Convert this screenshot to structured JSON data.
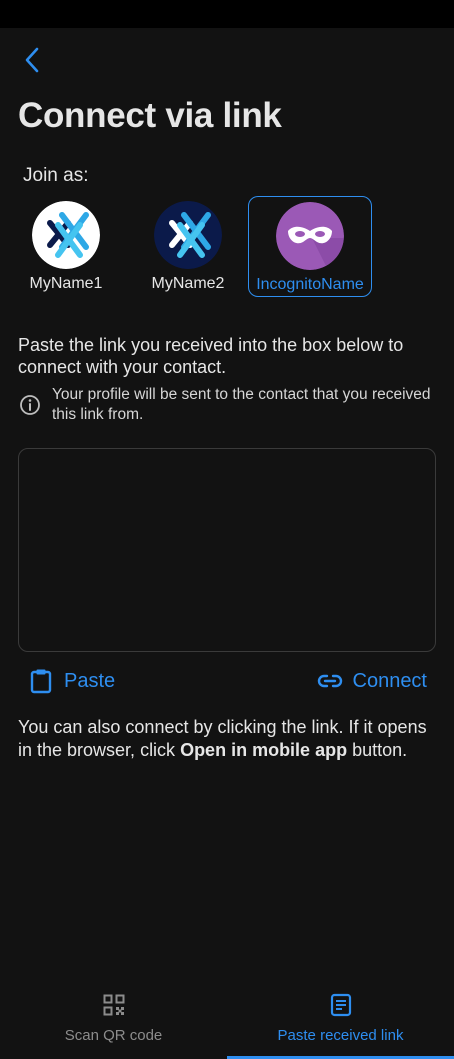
{
  "header": {
    "title": "Connect via link"
  },
  "join_as": {
    "label": "Join as:",
    "profiles": [
      {
        "name": "MyName1",
        "selected": false
      },
      {
        "name": "MyName2",
        "selected": false
      },
      {
        "name": "IncognitoName",
        "selected": true
      }
    ]
  },
  "instructions": "Paste the link you received into the box below to connect with your contact.",
  "info": "Your profile will be sent to the contact that you received this link from.",
  "link_input": {
    "value": "",
    "placeholder": ""
  },
  "actions": {
    "paste_label": "Paste",
    "connect_label": "Connect"
  },
  "also_connect": {
    "prefix": "You can also connect by clicking the link. If it opens in the browser, click ",
    "bold": "Open in mobile app",
    "suffix": " button."
  },
  "bottom_nav": {
    "tabs": [
      {
        "label": "Scan QR code",
        "icon": "qr-code-icon",
        "active": false
      },
      {
        "label": "Paste received link",
        "icon": "note-icon",
        "active": true
      }
    ]
  },
  "colors": {
    "accent": "#2e8ef0",
    "background": "#121212",
    "incognito": "#9b59b6"
  }
}
